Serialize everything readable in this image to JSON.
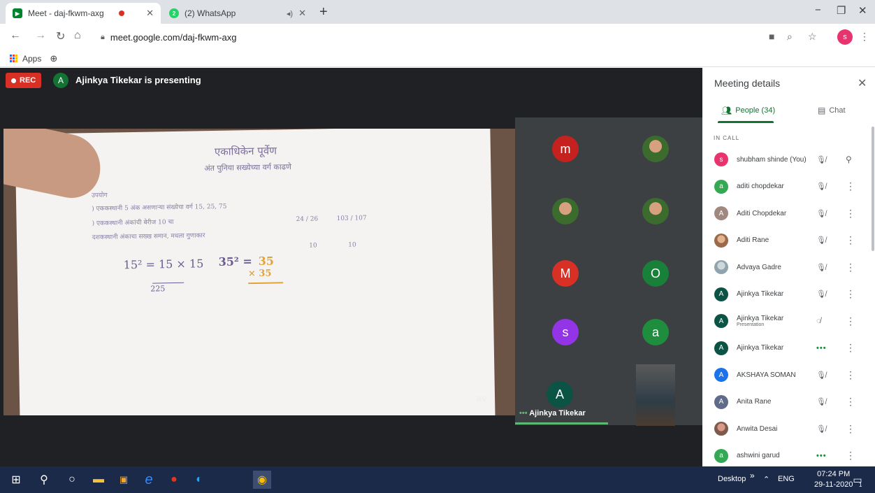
{
  "browser": {
    "tabs": [
      {
        "title": "Meet - daj-fkwm-axg",
        "icon": "meet-icon"
      },
      {
        "title": "(2) WhatsApp",
        "icon": "whatsapp-icon",
        "badge": "2"
      }
    ],
    "new_tab": "+",
    "window_controls": {
      "minimize": "−",
      "restore": "❐",
      "close": "✕"
    },
    "url": "meet.google.com/daj-fkwm-axg",
    "profile_initial": "s",
    "bookmarks": {
      "apps_label": "Apps"
    }
  },
  "meeting": {
    "rec_label": "REC",
    "presenter_initial": "A",
    "presenting_text": "Ajinkya Tikekar is presenting",
    "presentation_watermark": "av",
    "handwriting": {
      "title": "एकाधिकेन पूर्वेण",
      "subtitle": "अंत पुनिया सख्येच्या वर्ग काढणे",
      "line_1": "उपयोग",
      "line_2": ") एककस्थानी 5 अंक असणाऱ्या संख्येचा वर्ग     15, 25, 75",
      "line_3": ") एककस्थानी अंकांची बेरीज 10 चा",
      "line_4": "दशकस्थानी अंकाचा सख्ख समान, मधला गुणाकार",
      "frac_1": "24 / 26",
      "frac_2": "103 / 107",
      "ten_1": "10",
      "ten_2": "10",
      "math_1": "15² = 15 × 15",
      "math_1_result": "225",
      "math_2": "35² = ",
      "math_2_value": "35",
      "math_2_times": "× 35"
    },
    "tiles": [
      {
        "initial": "m",
        "color": "#c5221f"
      },
      {
        "initial": "",
        "photo": true
      },
      {
        "initial": "",
        "photo": true
      },
      {
        "initial": "",
        "photo": true
      },
      {
        "initial": "M",
        "color": "#d93025"
      },
      {
        "initial": "O",
        "color": "#188038"
      },
      {
        "initial": "s",
        "color": "#9334e6"
      },
      {
        "initial": "a",
        "color": "#1e8e3e"
      },
      {
        "initial": "A",
        "color": "#0b5345"
      }
    ],
    "active_tile_name": "Ajinkya Tikekar",
    "active_tile_indicator": "•••"
  },
  "panel": {
    "title": "Meeting details",
    "close": "✕",
    "tabs": {
      "people": "People (34)",
      "chat": "Chat"
    },
    "section": "IN CALL",
    "people": [
      {
        "name": "shubham shinde (You)",
        "initial": "s",
        "color": "#e8336f",
        "mic": "muted",
        "action": "pin"
      },
      {
        "name": "aditi chopdekar",
        "initial": "a",
        "color": "#34a853",
        "mic": "muted",
        "action": "more"
      },
      {
        "name": "Aditi Chopdekar",
        "initial": "A",
        "color": "#a1887f",
        "mic": "muted",
        "action": "more"
      },
      {
        "name": "Aditi Rane",
        "initial": "",
        "photo": true,
        "mic": "muted",
        "action": "more"
      },
      {
        "name": "Advaya Gadre",
        "initial": "",
        "photo": true,
        "mic": "muted",
        "action": "more"
      },
      {
        "name": "Ajinkya Tikekar",
        "initial": "A",
        "color": "#0b5345",
        "mic": "muted",
        "action": "more"
      },
      {
        "name": "Ajinkya Tikekar",
        "sub": "Presentation",
        "initial": "A",
        "color": "#0b5345",
        "mic": "presenting",
        "action": "more"
      },
      {
        "name": "Ajinkya Tikekar",
        "initial": "A",
        "color": "#0b5345",
        "mic": "speaking",
        "action": "more"
      },
      {
        "name": "AKSHAYA SOMAN",
        "initial": "A",
        "color": "#1a73e8",
        "mic": "muted",
        "action": "more"
      },
      {
        "name": "Anita Rane",
        "initial": "A",
        "color": "#5f6b8a",
        "mic": "muted",
        "action": "more"
      },
      {
        "name": "Anwita Desai",
        "initial": "",
        "photo": true,
        "mic": "muted",
        "action": "more"
      },
      {
        "name": "ashwini garud",
        "initial": "a",
        "color": "#34a853",
        "mic": "speaking",
        "action": "more"
      }
    ]
  },
  "taskbar": {
    "desktop_label": "Desktop",
    "chevrons": "»",
    "tray_up": "^",
    "lang": "ENG",
    "time": "07:24 PM",
    "date": "29-11-2020",
    "notification_count": "1"
  }
}
